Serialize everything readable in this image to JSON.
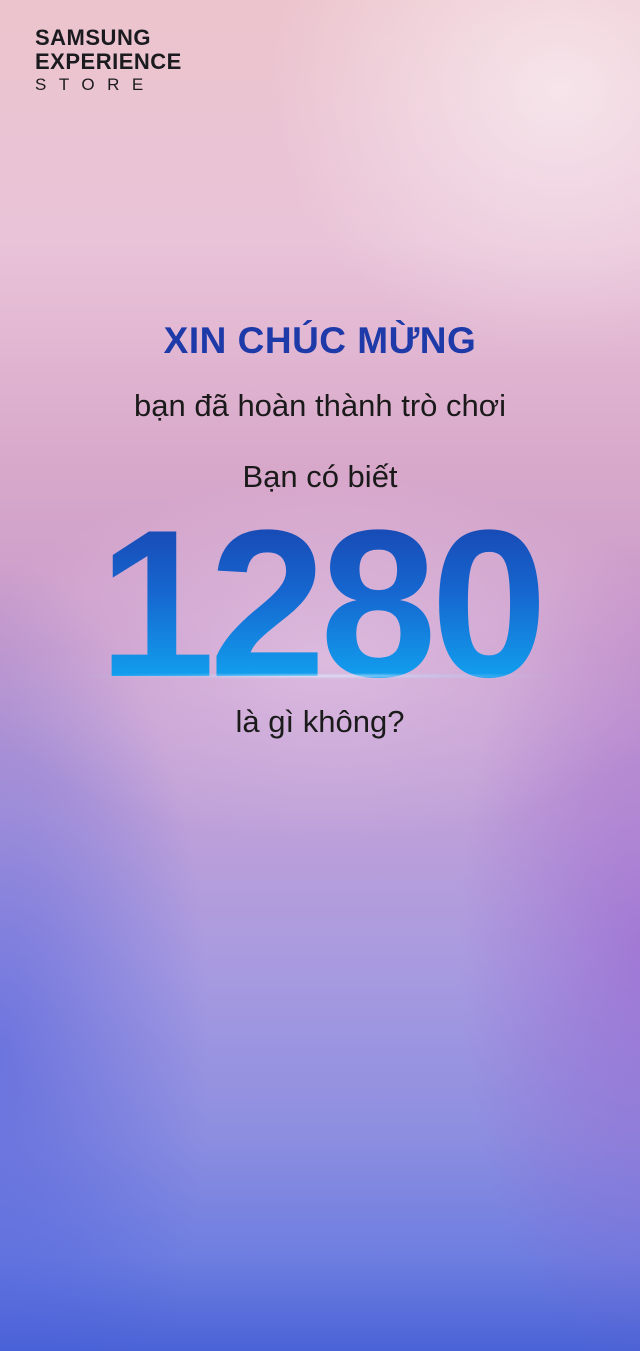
{
  "brand": {
    "line1": "SAMSUNG",
    "line2": "EXPERIENCE",
    "line3": "STORE"
  },
  "message": {
    "headline": "XIN CHÚC MỪNG",
    "subline": "bạn đã hoàn thành trò chơi",
    "question_top": "Bạn có biết",
    "big_number": "1280",
    "question_bottom": "là gì không?"
  },
  "colors": {
    "headline": "#1d3aa8",
    "number_top": "#1a3aa6",
    "number_bottom": "#23b7f5"
  }
}
